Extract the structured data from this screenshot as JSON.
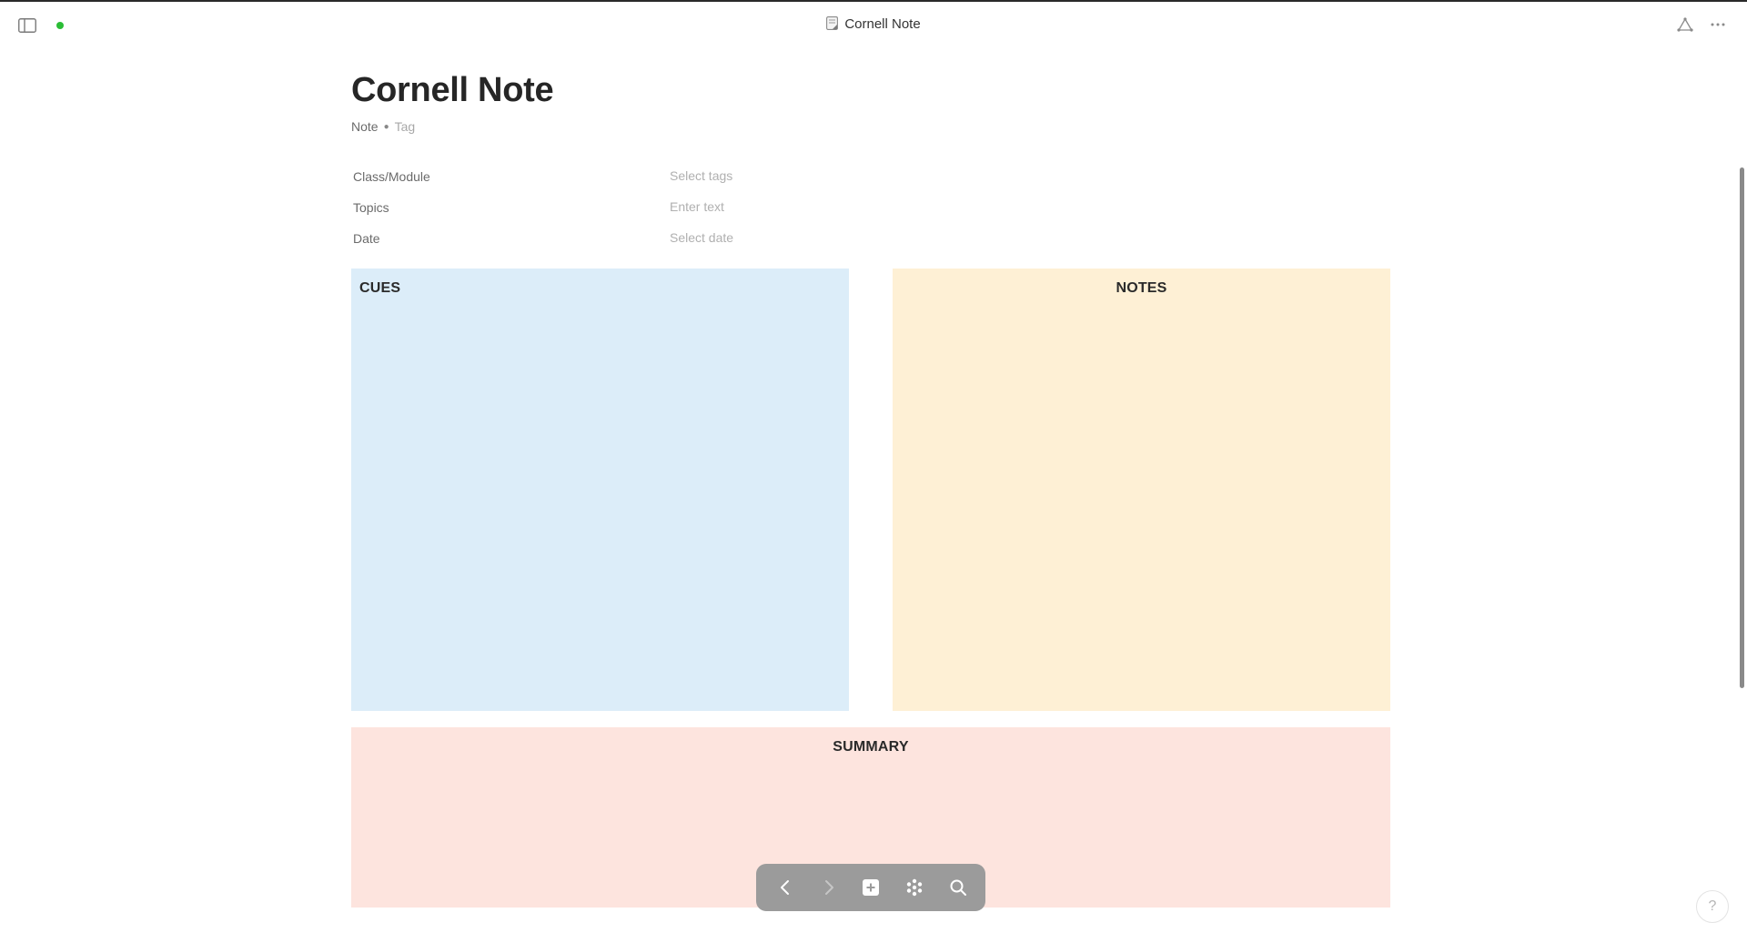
{
  "window": {
    "title": "Cornell Note"
  },
  "colors": {
    "sync_dot": "#2bbd36",
    "cues_bg": "#dcedf9",
    "notes_bg": "#fef0d5",
    "summary_bg": "#fde4de",
    "toolbar_bg": "#9b9b9b"
  },
  "document": {
    "title": "Cornell Note",
    "type": "Note",
    "tag_placeholder": "Tag"
  },
  "properties": [
    {
      "label": "Class/Module",
      "value": "Select tags"
    },
    {
      "label": "Topics",
      "value": "Enter text"
    },
    {
      "label": "Date",
      "value": "Select date"
    }
  ],
  "sections": {
    "cues": "CUES",
    "notes": "NOTES",
    "summary": "SUMMARY"
  },
  "toolbar": {
    "icons": [
      "back-icon",
      "forward-icon",
      "add-icon",
      "graph-icon",
      "search-icon"
    ]
  },
  "help": {
    "label": "?"
  }
}
